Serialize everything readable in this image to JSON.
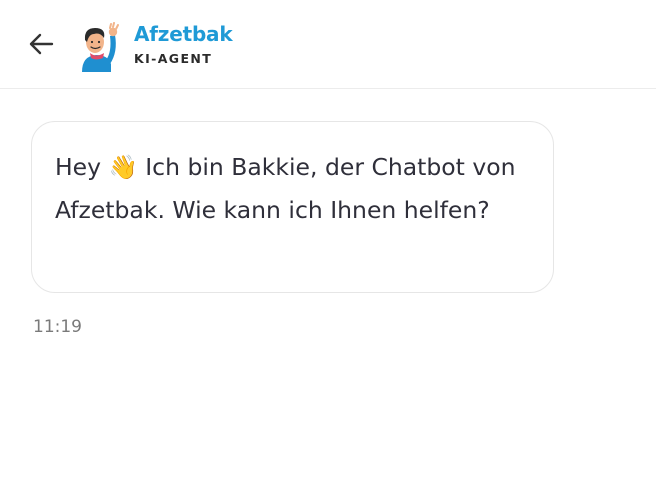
{
  "header": {
    "back_icon": "arrow-left-icon",
    "avatar_icon": "waving-person-avatar",
    "brand_name": "Afzetbak",
    "brand_subtitle": "KI-AGENT",
    "brand_color": "#1f9ad6"
  },
  "message": {
    "emoji": "👋",
    "text_before_emoji": "Hey ",
    "text_after_emoji": " Ich bin Bakkie, der Chatbot von Afzetbak. Wie kann ich Ihnen helfen?",
    "time": "11:19"
  }
}
